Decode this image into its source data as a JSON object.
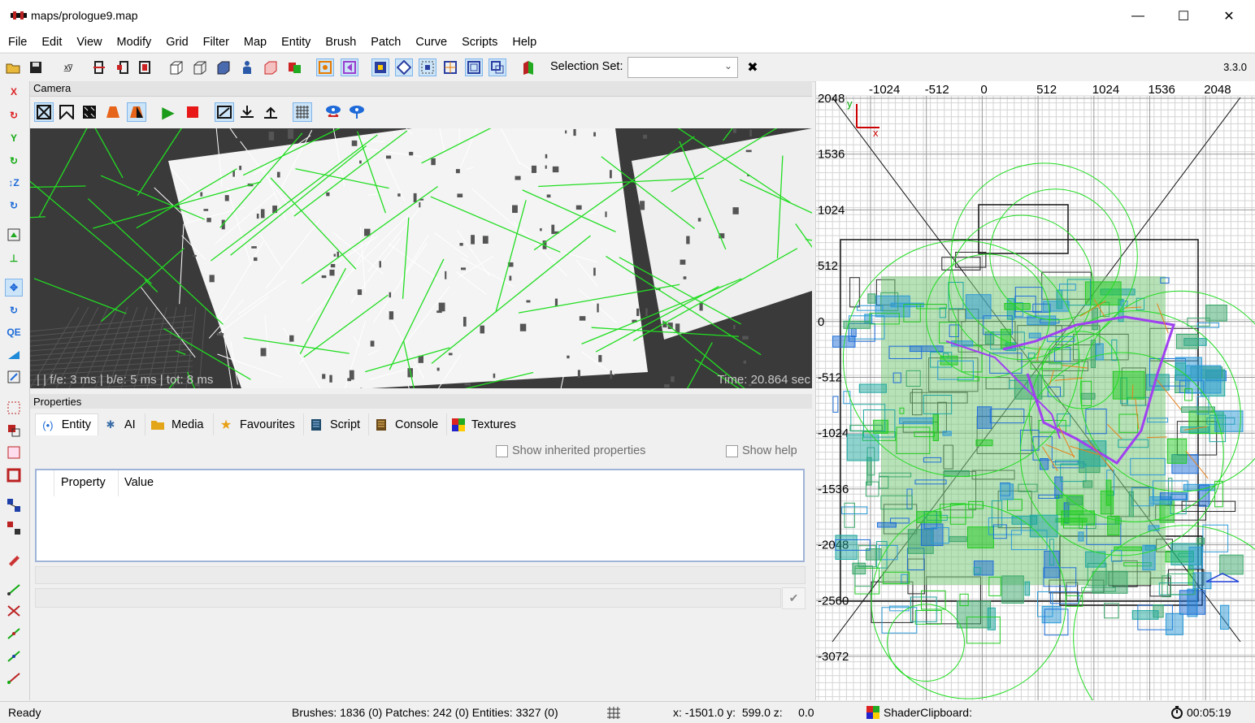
{
  "window": {
    "title": "maps/prologue9.map",
    "minimize_glyph": "—",
    "maximize_glyph": "☐",
    "close_glyph": "✕"
  },
  "menu": [
    "File",
    "Edit",
    "View",
    "Modify",
    "Grid",
    "Filter",
    "Map",
    "Entity",
    "Brush",
    "Patch",
    "Curve",
    "Scripts",
    "Help"
  ],
  "toolbar": {
    "icons": [
      "open-icon",
      "save-icon",
      "xyz-flip-icon",
      "clipper-icon",
      "csg-subtract-icon",
      "csg-merge-icon",
      "cube-icon",
      "cube-outline-icon",
      "texture-cube-icon",
      "entity-icon",
      "brush-cube-icon",
      "patch-icon",
      "filter-toggle-icon",
      "camera-toggle-icon",
      "select-complete-icon",
      "select-touching-icon",
      "select-inside-icon",
      "select-partial-icon",
      "select-face-icon",
      "select-overlay-icon",
      "surface-inspector-icon"
    ],
    "selection_set_label": "Selection Set:",
    "selection_set_value": "",
    "clear_glyph": "✖",
    "version": "3.3.0"
  },
  "left_tools": [
    "flip-x-icon",
    "rotate-x-icon",
    "flip-y-icon",
    "rotate-y-icon",
    "flip-z-icon",
    "rotate-z-icon",
    "texture-lock-icon",
    "snap-to-grid-icon",
    "translate-icon",
    "rotate-icon",
    "qe-tool-icon",
    "scale-icon",
    "resize-icon",
    "select-region-icon",
    "select-group-icon",
    "select-box-icon",
    "select-frame-icon",
    "node-link-icon",
    "node-unlink-icon",
    "entity-pick-icon",
    "path-a-icon",
    "path-b-icon",
    "path-c-icon",
    "path-d-icon",
    "path-e-icon"
  ],
  "camera": {
    "header": "Camera",
    "stats": "|  | f/e: 3 ms | b/e: 5 ms | tot: 8 ms",
    "time": "Time: 20.864 sec",
    "tools": [
      "wireframe-icon",
      "flat-shade-icon",
      "textured-icon",
      "lighting-icon",
      "shadow-icon",
      "play-icon",
      "stop-icon",
      "far-clip-icon",
      "clip-down-icon",
      "clip-up-icon",
      "grid-icon",
      "strafe-icon",
      "look-icon"
    ]
  },
  "properties": {
    "header": "Properties",
    "tabs": [
      {
        "label": "Entity",
        "icon": "entity-tab-icon",
        "active": true
      },
      {
        "label": "AI",
        "icon": "ai-tab-icon",
        "active": false
      },
      {
        "label": "Media",
        "icon": "media-tab-icon",
        "active": false
      },
      {
        "label": "Favourites",
        "icon": "star-icon",
        "active": false
      },
      {
        "label": "Script",
        "icon": "script-tab-icon",
        "active": false
      },
      {
        "label": "Console",
        "icon": "console-tab-icon",
        "active": false
      },
      {
        "label": "Textures",
        "icon": "textures-tab-icon",
        "active": false
      }
    ],
    "show_inherited": "Show inherited properties",
    "show_help": "Show help",
    "columns": [
      "Property",
      "Value"
    ],
    "apply_glyph": "✔"
  },
  "xy": {
    "top_labels": [
      "-1024",
      "-512",
      "0",
      "512",
      "1024",
      "1536",
      "2048"
    ],
    "left_labels": [
      "2048",
      "1536",
      "1024",
      "512",
      "0",
      "-512",
      "-1024",
      "-1536",
      "-2048",
      "-2560",
      "-3072"
    ],
    "axis_x": "x",
    "axis_y": "y"
  },
  "status": {
    "ready": "Ready",
    "counts": "Brushes: 1836 (0) Patches: 242 (0) Entities: 3327 (0)",
    "coords": "x: -1501.0 y:  599.0 z:     0.0",
    "shader": "ShaderClipboard:",
    "timer": "00:05:19"
  },
  "colors": {
    "accent": "#cce4f7",
    "wire_green": "#22dd22",
    "wire_white": "#ffffff",
    "xy_blue": "#1f6fd8",
    "xy_purple": "#a040f0"
  }
}
